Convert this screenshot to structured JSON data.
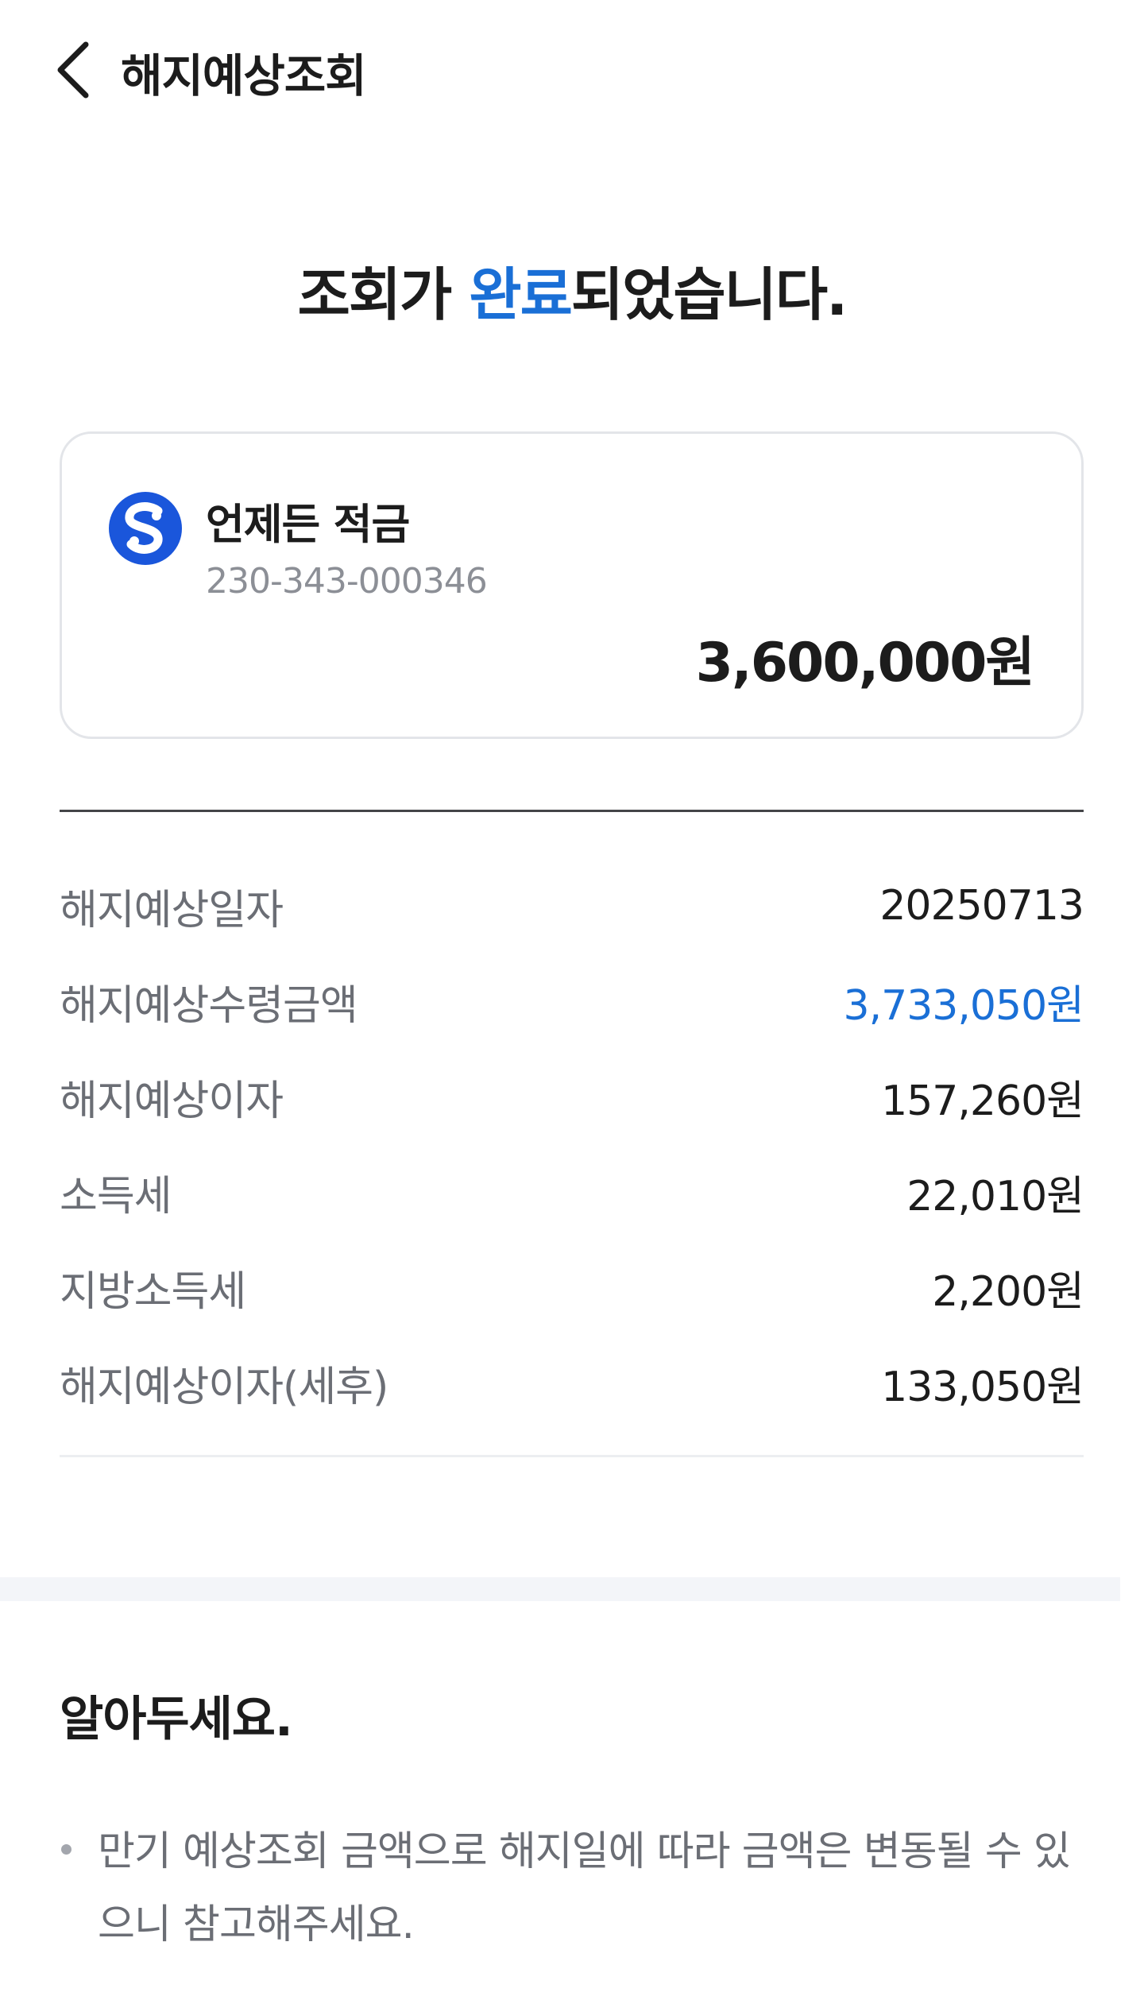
{
  "header": {
    "title": "해지예상조회"
  },
  "result": {
    "prefix": "조회가 ",
    "accent": "완료",
    "suffix": "되었습니다."
  },
  "account": {
    "name": "언제든 적금",
    "number": "230-343-000346",
    "balance": "3,600,000원",
    "logo_icon": "shinhan-bank-logo",
    "logo_color": "#1a56db"
  },
  "details": [
    {
      "label": "해지예상일자",
      "value": "20250713",
      "accent": false
    },
    {
      "label": "해지예상수령금액",
      "value": "3,733,050원",
      "accent": true
    },
    {
      "label": "해지예상이자",
      "value": "157,260원",
      "accent": false
    },
    {
      "label": "소득세",
      "value": "22,010원",
      "accent": false
    },
    {
      "label": "지방소득세",
      "value": "2,200원",
      "accent": false
    },
    {
      "label": "해지예상이자(세후)",
      "value": "133,050원",
      "accent": false
    }
  ],
  "notice": {
    "title": "알아두세요.",
    "items": [
      "만기 예상조회 금액으로 해지일에 따라 금액은 변동될 수 있으니 참고해주세요."
    ]
  },
  "colors": {
    "accent": "#1a6fd6",
    "text": "#1c1c1c",
    "muted": "#6b6e75"
  }
}
